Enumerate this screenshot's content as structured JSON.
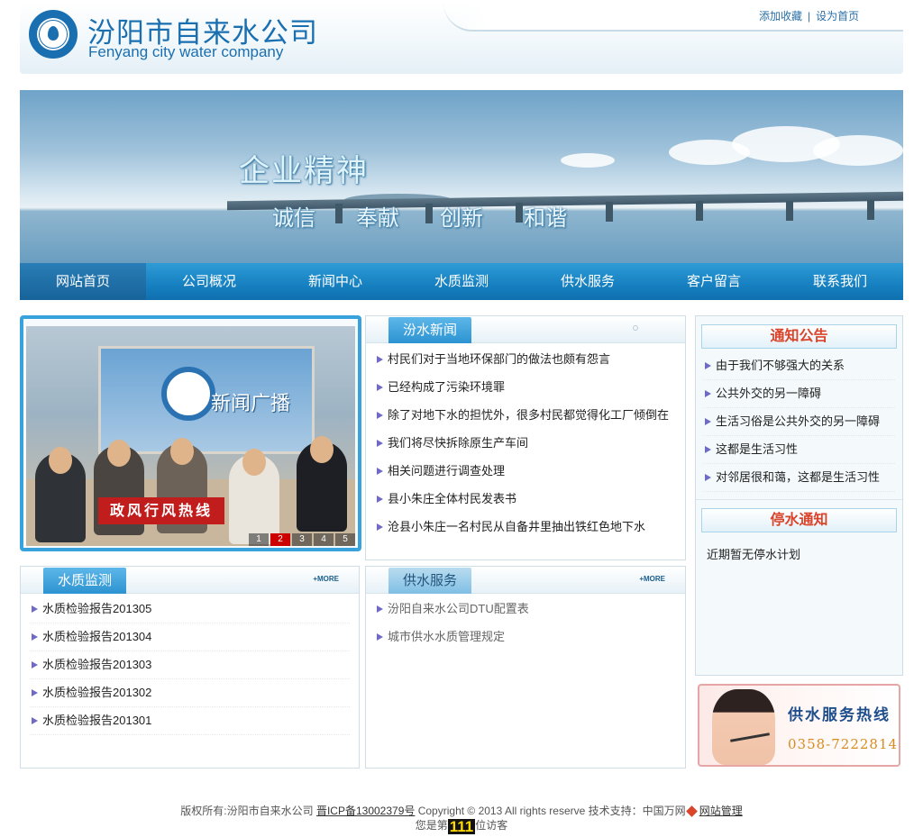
{
  "header": {
    "brand_cn": "汾阳市自来水公司",
    "brand_en": "Fenyang city water company",
    "links": [
      "添加收藏",
      "设为首页"
    ],
    "accent": "#1a6fb0"
  },
  "banner": {
    "slogan": "企业精神",
    "words": [
      "诚信",
      "奉献",
      "创新",
      "和谐"
    ]
  },
  "nav": {
    "items": [
      "网站首页",
      "公司概况",
      "新闻中心",
      "水质监测",
      "供水服务",
      "客户留言",
      "联系我们"
    ],
    "active_index": 0
  },
  "slideshow": {
    "screen_text": "新闻广播",
    "banner_text": "政风行风热线",
    "pages": [
      "1",
      "2",
      "3",
      "4",
      "5"
    ],
    "active_page": "2"
  },
  "news": {
    "title": "汾水新闻",
    "items": [
      "村民们对于当地环保部门的做法也颇有怨言",
      "已经构成了污染环境罪",
      "除了对地下水的担忧外，很多村民都觉得化工厂倾倒在",
      "我们将尽快拆除原生产车间",
      "相关问题进行调查处理",
      "县小朱庄全体村民发表书",
      "沧县小朱庄一名村民从自备井里抽出铁红色地下水"
    ]
  },
  "water_quality": {
    "title": "水质监测",
    "more": "+MORE",
    "items": [
      "水质检验报告201305",
      "水质检验报告201304",
      "水质检验报告201303",
      "水质检验报告201302",
      "水质检验报告201301"
    ]
  },
  "supply": {
    "title": "供水服务",
    "more": "+MORE",
    "items": [
      "汾阳自来水公司DTU配置表",
      "城市供水水质管理规定"
    ]
  },
  "notice": {
    "title": "通知公告",
    "items": [
      "由于我们不够强大的关系",
      "公共外交的另一障碍",
      "生活习俗是公共外交的另一障碍",
      "这都是生活习性",
      "对邻居很和蔼，这都是生活习性"
    ],
    "stop_title": "停水通知",
    "stop_text": "近期暂无停水计划"
  },
  "hotline": {
    "title": "供水服务热线",
    "phone": "0358-7222814"
  },
  "footer": {
    "copyright_prefix": "版权所有:汾阳市自来水公司",
    "icp": "晋ICP备13002379号",
    "copyright": "Copyright © 2013 All rights reserve",
    "support_label": "技术支持：中国万网",
    "admin": "网站管理",
    "visitor_prefix": "您是第",
    "visitor_count": "111",
    "visitor_suffix": "位访客"
  }
}
